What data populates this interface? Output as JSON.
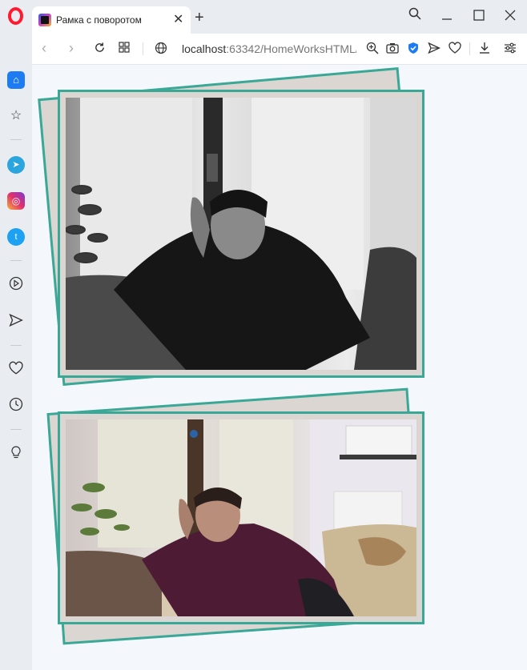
{
  "browser": {
    "tab_title": "Рамка с поворотом",
    "url_host": "localhost",
    "url_rest": ":63342/HomeWorksHTML/"
  },
  "icons": {
    "logo": "opera-logo-icon",
    "sidebar": [
      "home-icon",
      "star-icon",
      "telegram-icon",
      "instagram-icon",
      "twitter-icon",
      "player-icon",
      "send-icon",
      "heart-icon",
      "history-icon",
      "lightbulb-icon"
    ]
  },
  "colors": {
    "frame_border": "#3aa896",
    "frame_fill": "#dbd6d1",
    "page_background": "#f4f8fd"
  },
  "content": {
    "photos": [
      {
        "style": "black-and-white"
      },
      {
        "style": "color"
      }
    ]
  }
}
